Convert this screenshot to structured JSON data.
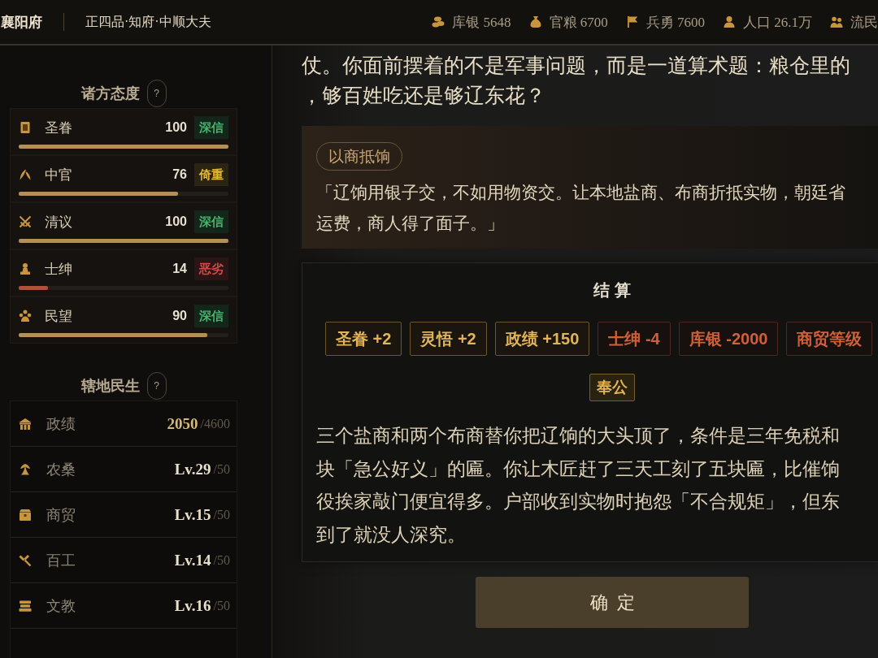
{
  "header": {
    "title": "襄阳府",
    "rank": "正四品·知府·中顺大夫",
    "resources": [
      {
        "label": "库银 5648"
      },
      {
        "label": "官粮 6700"
      },
      {
        "label": "兵勇 7600"
      },
      {
        "label": "人口 26.1万"
      },
      {
        "label": "流民"
      }
    ]
  },
  "attitudes": {
    "title": "诸方态度",
    "help": "?",
    "items": [
      {
        "name": "圣眷",
        "value": "100",
        "status": "深信",
        "kind": "trusted",
        "level": 1
      },
      {
        "name": "中官",
        "value": "76",
        "status": "倚重",
        "kind": "relied",
        "level": 0.76
      },
      {
        "name": "清议",
        "value": "100",
        "status": "深信",
        "kind": "trusted",
        "level": 1
      },
      {
        "name": "士绅",
        "value": "14",
        "status": "恶劣",
        "kind": "hostile",
        "level": 0.14
      },
      {
        "name": "民望",
        "value": "90",
        "status": "深信",
        "kind": "trusted",
        "level": 0.9
      }
    ]
  },
  "livelihood": {
    "title": "辖地民生",
    "help": "?",
    "rows": [
      {
        "name": "政绩",
        "value": "2050",
        "max": "/4600",
        "kind": "score"
      },
      {
        "name": "农桑",
        "value": "Lv.29",
        "max": "/50",
        "kind": "grade"
      },
      {
        "name": "商贸",
        "value": "Lv.15",
        "max": "/50",
        "kind": "grade"
      },
      {
        "name": "百工",
        "value": "Lv.14",
        "max": "/50",
        "kind": "grade"
      },
      {
        "name": "文教",
        "value": "Lv.16",
        "max": "/50",
        "kind": "grade"
      }
    ]
  },
  "narrative": {
    "lines": [
      "仗。你面前摆着的不是军事问题，而是一道算术题：粮仓里的",
      "，够百姓吃还是够辽东花？"
    ]
  },
  "choice": {
    "tag": "以商抵饷",
    "lines": [
      "「辽饷用银子交，不如用物资交。让本地盐商、布商折抵实物，朝廷省",
      "运费，商人得了面子。」"
    ]
  },
  "settlement": {
    "title": "结算",
    "effects": [
      {
        "text": "圣眷 +2",
        "kind": "gain"
      },
      {
        "text": "灵悟 +2",
        "kind": "gain"
      },
      {
        "text": "政绩 +150",
        "kind": "gain"
      },
      {
        "text": "士绅 -4",
        "kind": "loss"
      },
      {
        "text": "库银 -2000",
        "kind": "loss"
      },
      {
        "text": "商贸等级",
        "kind": "loss"
      }
    ],
    "traits": [
      "奉公"
    ],
    "lines": [
      "三个盐商和两个布商替你把辽饷的大头顶了，条件是三年免税和",
      "块「急公好义」的匾。你让木匠赶了三天工刻了五块匾，比催饷",
      "役挨家敲门便宜得多。户部收到实物时抱怨「不合规矩」，但东",
      "到了就没人深究。"
    ]
  },
  "confirm": {
    "label": "确定"
  }
}
